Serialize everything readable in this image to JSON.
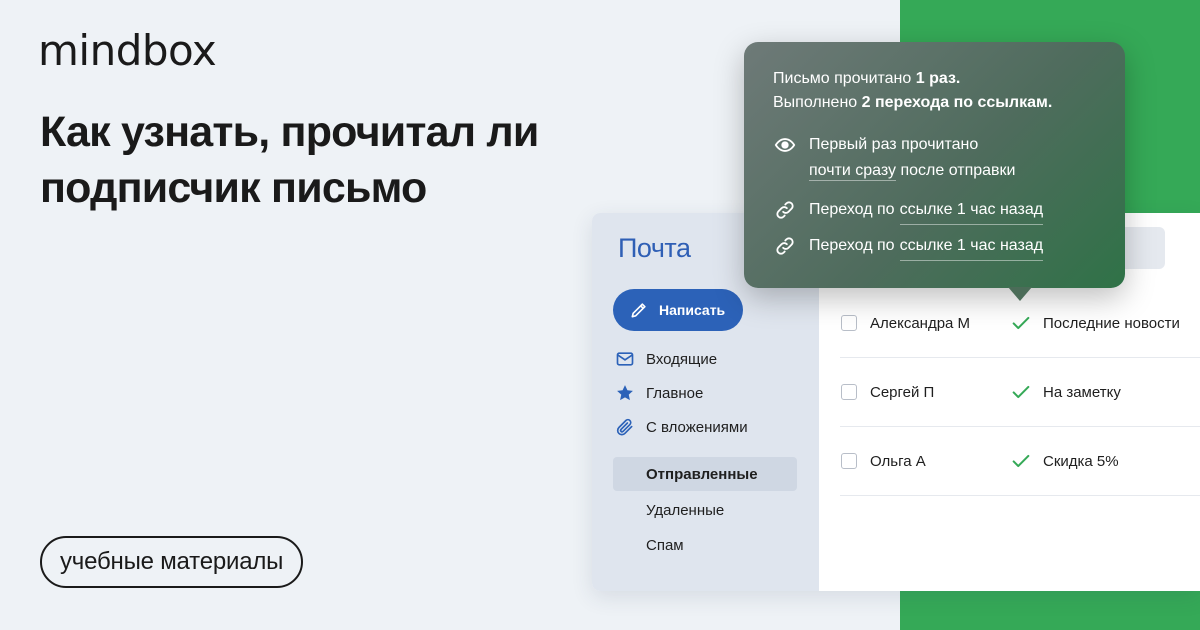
{
  "brand": {
    "logo": "mindbox"
  },
  "headline": {
    "line1": "Как узнать, прочитал ли",
    "line2": "подписчик письмо"
  },
  "badge": {
    "label": "учебные материалы"
  },
  "colors": {
    "green": "#35a957",
    "primary_blue": "#2c62b8",
    "check_green": "#35a957"
  },
  "tooltip": {
    "line1_prefix": "Письмо прочитано ",
    "line1_strong": "1 раз.",
    "line2_prefix": "Выполнено ",
    "line2_strong": "2 перехода по ссылкам.",
    "items": [
      {
        "icon": "eye-icon",
        "text_a": "Первый раз прочитано",
        "text_b_ul": "почти сразу",
        "text_b_rest": " после отправки"
      },
      {
        "icon": "link-icon",
        "text_prefix": "Переход по ",
        "text_ul": "ссылке 1 час назад"
      },
      {
        "icon": "link-icon",
        "text_prefix": "Переход по ",
        "text_ul": "ссылке 1 час назад"
      }
    ]
  },
  "mail": {
    "title": "Почта",
    "compose_label": "Написать",
    "nav": [
      {
        "icon": "envelope-icon",
        "label": "Входящие"
      },
      {
        "icon": "star-icon",
        "label": "Главное"
      },
      {
        "icon": "paperclip-icon",
        "label": "С вложениями"
      },
      {
        "icon": "",
        "label": "Отправленные",
        "active": true
      },
      {
        "icon": "",
        "label": "Удаленные"
      },
      {
        "icon": "",
        "label": "Спам"
      }
    ],
    "rows": [
      {
        "sender": "Александра М",
        "subject": "Последние новости"
      },
      {
        "sender": "Сергей П",
        "subject": "На заметку"
      },
      {
        "sender": "Ольга А",
        "subject": "Скидка 5%"
      }
    ]
  }
}
